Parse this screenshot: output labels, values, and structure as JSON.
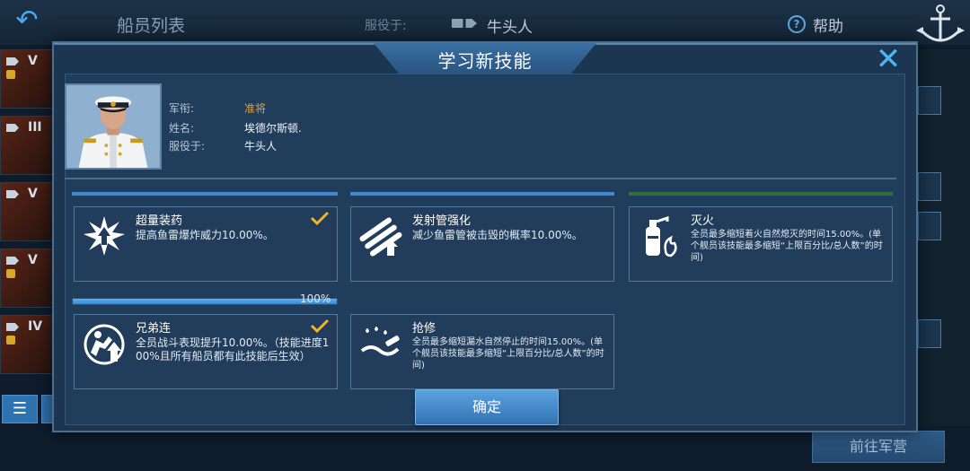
{
  "background": {
    "title": "船员列表",
    "serving_label": "服役于:",
    "serving_ship": "牛头人",
    "help_label": "帮助",
    "goto_camp": "前往军营",
    "ship_ranks": [
      "V",
      "III",
      "V",
      "V",
      "IV"
    ]
  },
  "dialog": {
    "title": "学习新技能",
    "confirm": "确定"
  },
  "crew": {
    "rank_label": "军衔:",
    "rank_value": "准将",
    "name_label": "姓名:",
    "name_value": "埃德尔斯顿.",
    "serve_label": "服役于:",
    "serve_value": "牛头人"
  },
  "skills": [
    {
      "name": "超量装药",
      "desc": "提高鱼雷爆炸威力10.00%。",
      "learned": true,
      "icon": "explosive-charge-icon"
    },
    {
      "name": "发射管强化",
      "desc": "减少鱼雷管被击毁的概率10.00%。",
      "learned": false,
      "icon": "torpedo-tube-icon"
    },
    {
      "name": "灭火",
      "desc": "全员最多缩短着火自然熄灭的时间15.00%。(单个舰员该技能最多缩短“上限百分比/总人数”的时间)",
      "learned": false,
      "icon": "fire-extinguisher-icon"
    },
    {
      "name": "兄弟连",
      "desc": "全员战斗表现提升10.00%。（技能进度100%且所有船员都有此技能后生效）",
      "learned": true,
      "icon": "brotherhood-icon"
    },
    {
      "name": "抢修",
      "desc": "全员最多缩短漏水自然停止的时间15.00%。(单个舰员该技能最多缩短“上限百分比/总人数”的时间)",
      "learned": false,
      "icon": "repair-icon"
    }
  ],
  "progress": {
    "value": 1.0,
    "label": "100%"
  },
  "colors": {
    "accent": "#4fb4f4",
    "rank": "#e2a13c",
    "check": "#f0b429"
  }
}
